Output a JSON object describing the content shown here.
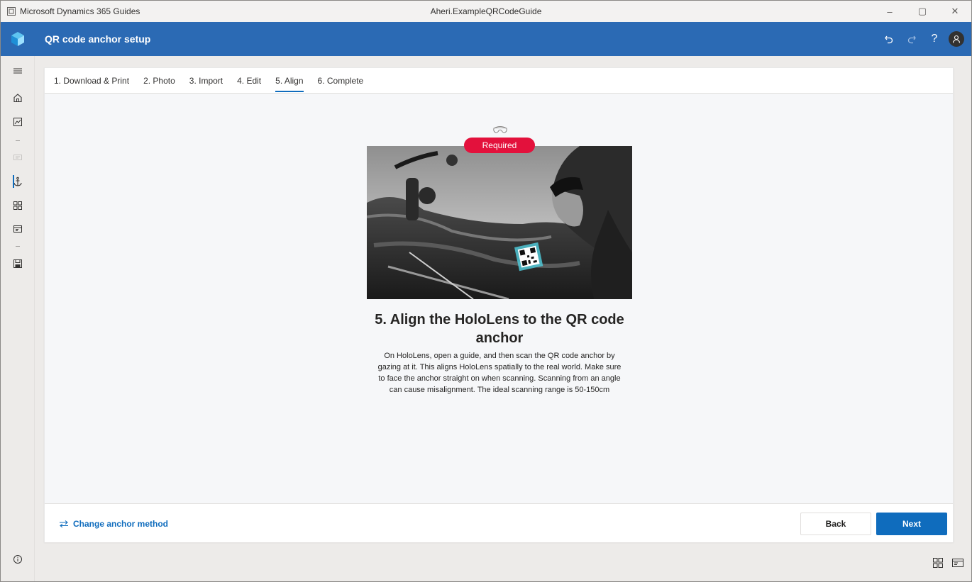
{
  "titlebar": {
    "app_name": "Microsoft Dynamics 365 Guides",
    "document_name": "Aheri.ExampleQRCodeGuide",
    "minimize": "–",
    "restore": "▢",
    "close": "✕"
  },
  "appbar": {
    "title": "QR code anchor setup",
    "undo_icon": "undo-icon",
    "redo_icon": "redo-icon",
    "help_label": "?",
    "accent": "#2b6ab4"
  },
  "sidebar": {
    "items": [
      {
        "name": "home",
        "icon": "home-icon"
      },
      {
        "name": "analytics",
        "icon": "analytics-icon"
      },
      {
        "name": "steps",
        "icon": "steps-icon"
      },
      {
        "name": "anchor",
        "icon": "anchor-icon",
        "active": true
      },
      {
        "name": "outline",
        "icon": "outline-icon"
      },
      {
        "name": "step-view",
        "icon": "step-view-icon"
      },
      {
        "name": "save",
        "icon": "save-icon"
      }
    ]
  },
  "tabs": [
    {
      "label": "1. Download & Print"
    },
    {
      "label": "2. Photo"
    },
    {
      "label": "3. Import"
    },
    {
      "label": "4. Edit"
    },
    {
      "label": "5. Align",
      "active": true
    },
    {
      "label": "6. Complete"
    }
  ],
  "main": {
    "badge": "Required",
    "heading": "5. Align the HoloLens to the QR code anchor",
    "description": "On HoloLens, open a guide, and then scan the QR code anchor by gazing at it. This aligns HoloLens spatially to the real world. Make sure to face the anchor straight on when scanning. Scanning from an angle can cause misalignment. The ideal scanning range is 50-150cm",
    "badge_color": "#e3113c"
  },
  "footer": {
    "change_anchor": "Change anchor method",
    "back": "Back",
    "next": "Next",
    "primary_color": "#0f6cbd"
  }
}
